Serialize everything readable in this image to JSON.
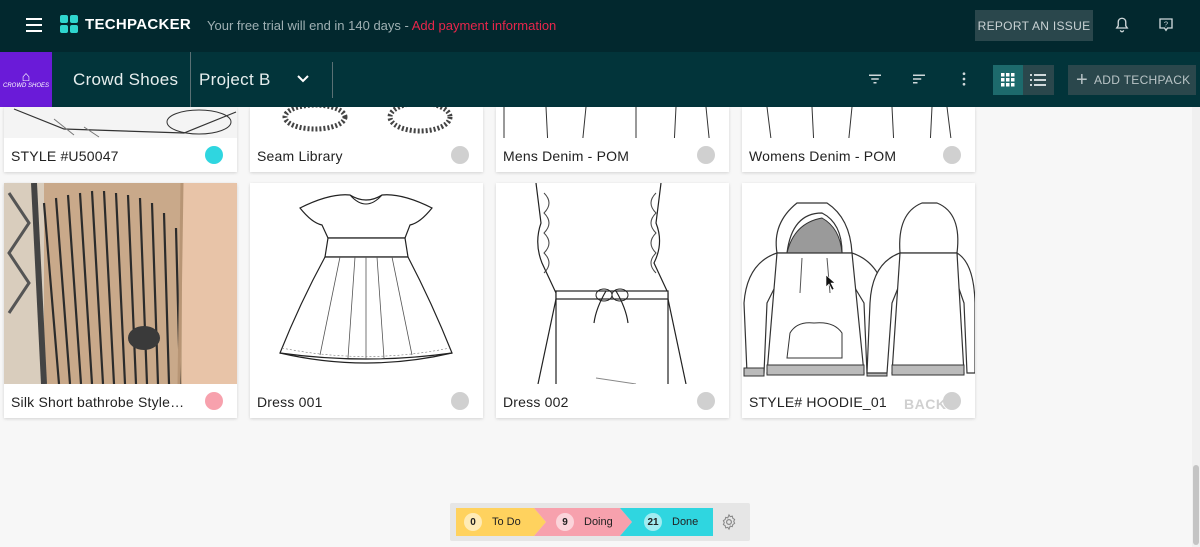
{
  "header": {
    "app_name": "TECHPACKER",
    "trial_text": "Your free trial will end in 140 days",
    "trial_separator": " - ",
    "payment_link": "Add payment information",
    "report_button": "REPORT AN ISSUE"
  },
  "subheader": {
    "company": "Crowd Shoes",
    "brand_thumb_text": "CROWD SHOES",
    "project": "Project B",
    "add_button": "ADD TECHPACK",
    "view_mode": "grid"
  },
  "cards_top": [
    {
      "label": "STYLE #U50047",
      "status_color": "#2fd6e0"
    },
    {
      "label": "Seam Library",
      "status_color": "#d0d0d0"
    },
    {
      "label": "Mens Denim - POM",
      "status_color": "#d0d0d0"
    },
    {
      "label": "Womens Denim - POM",
      "status_color": "#d0d0d0"
    }
  ],
  "cards_bottom": [
    {
      "label": "Silk Short bathrobe Style…",
      "status_color": "#f7a1ad"
    },
    {
      "label": "Dress 001",
      "status_color": "#d0d0d0"
    },
    {
      "label": "Dress 002",
      "status_color": "#d0d0d0"
    },
    {
      "label": "STYLE# HOODIE_01",
      "status_color": "#d0d0d0",
      "watermark": "BACK"
    }
  ],
  "status_summary": {
    "todo": {
      "count": "0",
      "label": "To Do",
      "color": "#ffd25e"
    },
    "doing": {
      "count": "9",
      "label": "Doing",
      "color": "#f7a1ad"
    },
    "done": {
      "count": "21",
      "label": "Done",
      "color": "#2fd6e0"
    }
  }
}
